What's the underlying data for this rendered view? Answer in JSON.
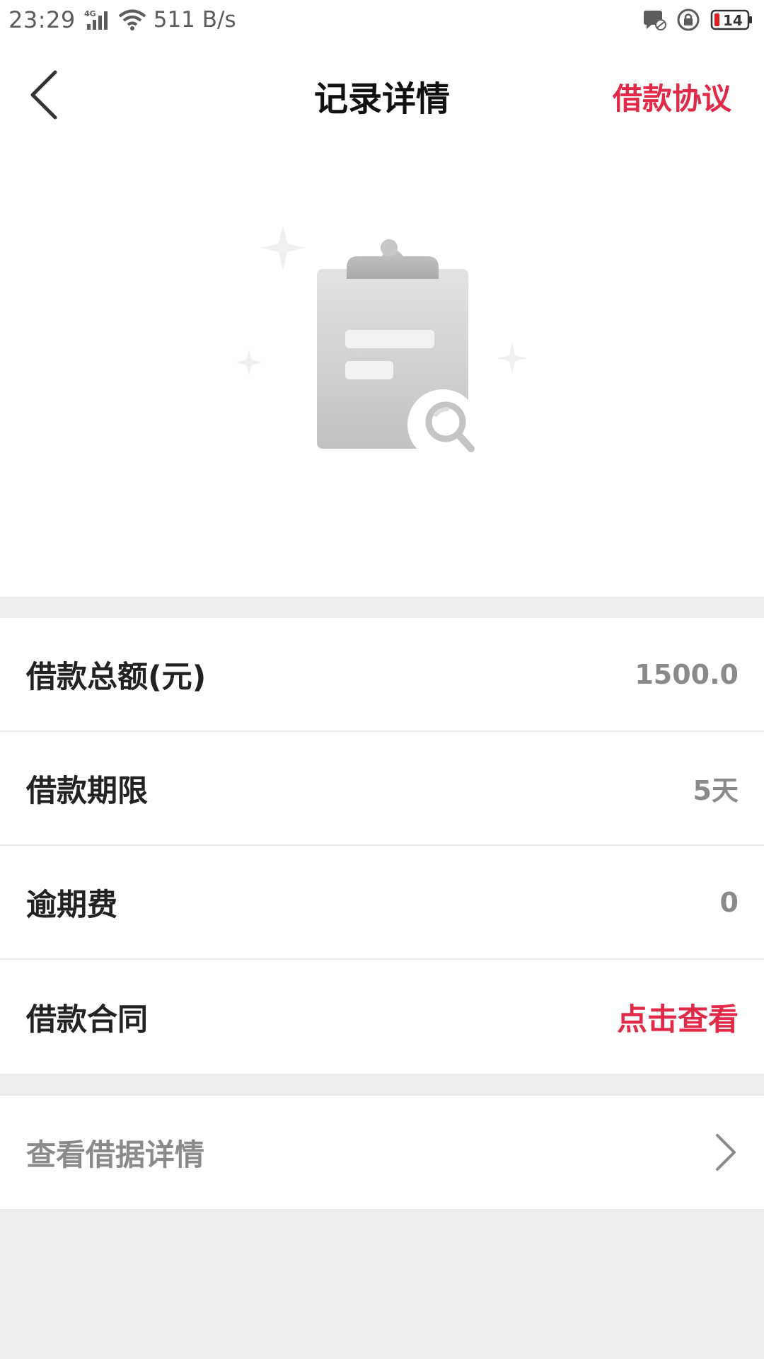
{
  "status_bar": {
    "time": "23:29",
    "network": "4G",
    "speed": "511 B/s",
    "battery": "14",
    "icons": [
      "signal-icon",
      "wifi-icon",
      "message-icon",
      "rotation-lock-icon",
      "battery-icon"
    ]
  },
  "header": {
    "title": "记录详情",
    "agreement_link": "借款协议",
    "back_icon": "back-arrow-icon"
  },
  "hero": {
    "illustration": "clipboard-search-icon"
  },
  "details": {
    "rows": [
      {
        "label": "借款总额(元)",
        "value": "1500.0"
      },
      {
        "label": "借款期限",
        "value": "5天"
      },
      {
        "label": "逾期费",
        "value": "0"
      },
      {
        "label": "借款合同",
        "value": "点击查看"
      }
    ]
  },
  "receipt": {
    "label": "查看借据详情",
    "icon": "chevron-right-icon"
  },
  "colors": {
    "accent": "#e02a48",
    "background": "#eeeeee",
    "label": "#222222",
    "value": "#8a8a8a"
  }
}
